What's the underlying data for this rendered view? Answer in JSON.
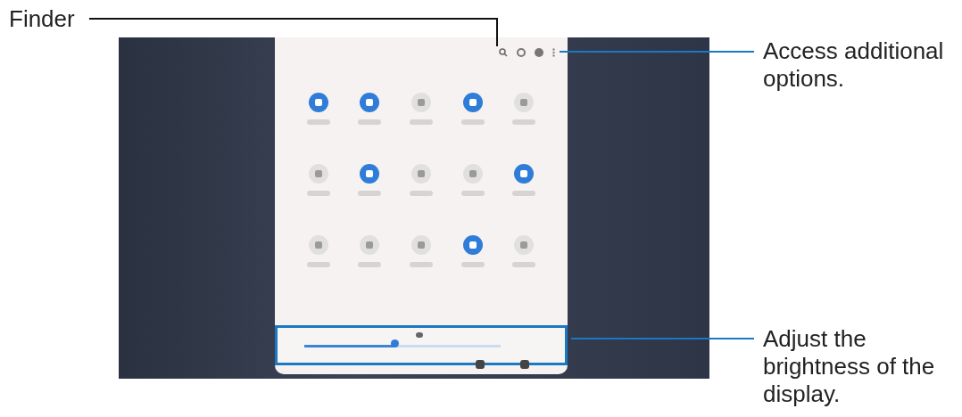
{
  "callouts": [
    {
      "text": "Finder"
    },
    {
      "text": "Access additional options."
    },
    {
      "text": "Adjust the brightness of the display."
    }
  ],
  "quick_panel": {
    "tiles": [
      {
        "on": true
      },
      {
        "on": true
      },
      {
        "on": false
      },
      {
        "on": true
      },
      {
        "on": false
      },
      {
        "on": false
      },
      {
        "on": true
      },
      {
        "on": false
      },
      {
        "on": false
      },
      {
        "on": true
      },
      {
        "on": false
      },
      {
        "on": false
      },
      {
        "on": false
      },
      {
        "on": true
      },
      {
        "on": false
      }
    ],
    "brightness": {
      "level": 0.46
    }
  }
}
